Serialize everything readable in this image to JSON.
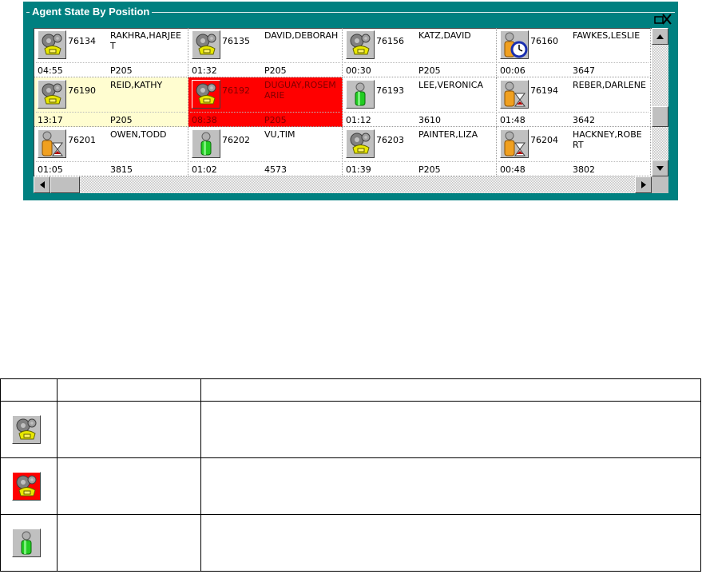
{
  "panel": {
    "title": "Agent State By Position"
  },
  "colors": {
    "panel_bg": "#008080",
    "highlight_yellow": "#fffdd0",
    "highlight_red": "#ff0000",
    "icon_face": "#c0c0c0"
  },
  "agents": [
    {
      "icon": "gear-phone-icon",
      "position": "76134",
      "name": "RAKHRA,HARJEET",
      "time": "04:55",
      "ext": "P205",
      "highlight": ""
    },
    {
      "icon": "gear-phone-icon",
      "position": "76135",
      "name": "DAVID,DEBORAH",
      "time": "01:32",
      "ext": "P205",
      "highlight": ""
    },
    {
      "icon": "gear-phone-icon",
      "position": "76156",
      "name": "KATZ,DAVID",
      "time": "00:30",
      "ext": "P205",
      "highlight": ""
    },
    {
      "icon": "person-clock-icon",
      "position": "76160",
      "name": "FAWKES,LESLIE",
      "time": "00:06",
      "ext": "3647",
      "highlight": ""
    },
    {
      "icon": "gear-phone-icon",
      "position": "76190",
      "name": "REID,KATHY",
      "time": "13:17",
      "ext": "P205",
      "highlight": "yellow"
    },
    {
      "icon": "gear-phone-icon",
      "position": "76192",
      "name": "DUGUAY,ROSEMARIE",
      "time": "08:38",
      "ext": "P205",
      "highlight": "red"
    },
    {
      "icon": "green-person-icon",
      "position": "76193",
      "name": "LEE,VERONICA",
      "time": "01:12",
      "ext": "3610",
      "highlight": ""
    },
    {
      "icon": "person-hourglass-icon",
      "position": "76194",
      "name": "REBER,DARLENE",
      "time": "01:48",
      "ext": "3642",
      "highlight": ""
    },
    {
      "icon": "person-hourglass-icon",
      "position": "76201",
      "name": "OWEN,TODD",
      "time": "01:05",
      "ext": "3815",
      "highlight": ""
    },
    {
      "icon": "green-person-icon",
      "position": "76202",
      "name": "VU,TIM",
      "time": "01:02",
      "ext": "4573",
      "highlight": ""
    },
    {
      "icon": "gear-phone-icon",
      "position": "76203",
      "name": "PAINTER,LIZA",
      "time": "01:39",
      "ext": "P205",
      "highlight": ""
    },
    {
      "icon": "person-hourglass-icon",
      "position": "76204",
      "name": "HACKNEY,ROBERT",
      "time": "00:48",
      "ext": "3802",
      "highlight": ""
    }
  ],
  "legend": {
    "headers": [
      "",
      "",
      ""
    ],
    "rows": [
      {
        "icon": "gear-phone-icon",
        "variant": "normal",
        "state": "",
        "description": ""
      },
      {
        "icon": "gear-phone-icon",
        "variant": "red",
        "state": "",
        "description": ""
      },
      {
        "icon": "green-person-icon",
        "variant": "normal",
        "state": "",
        "description": ""
      }
    ]
  }
}
